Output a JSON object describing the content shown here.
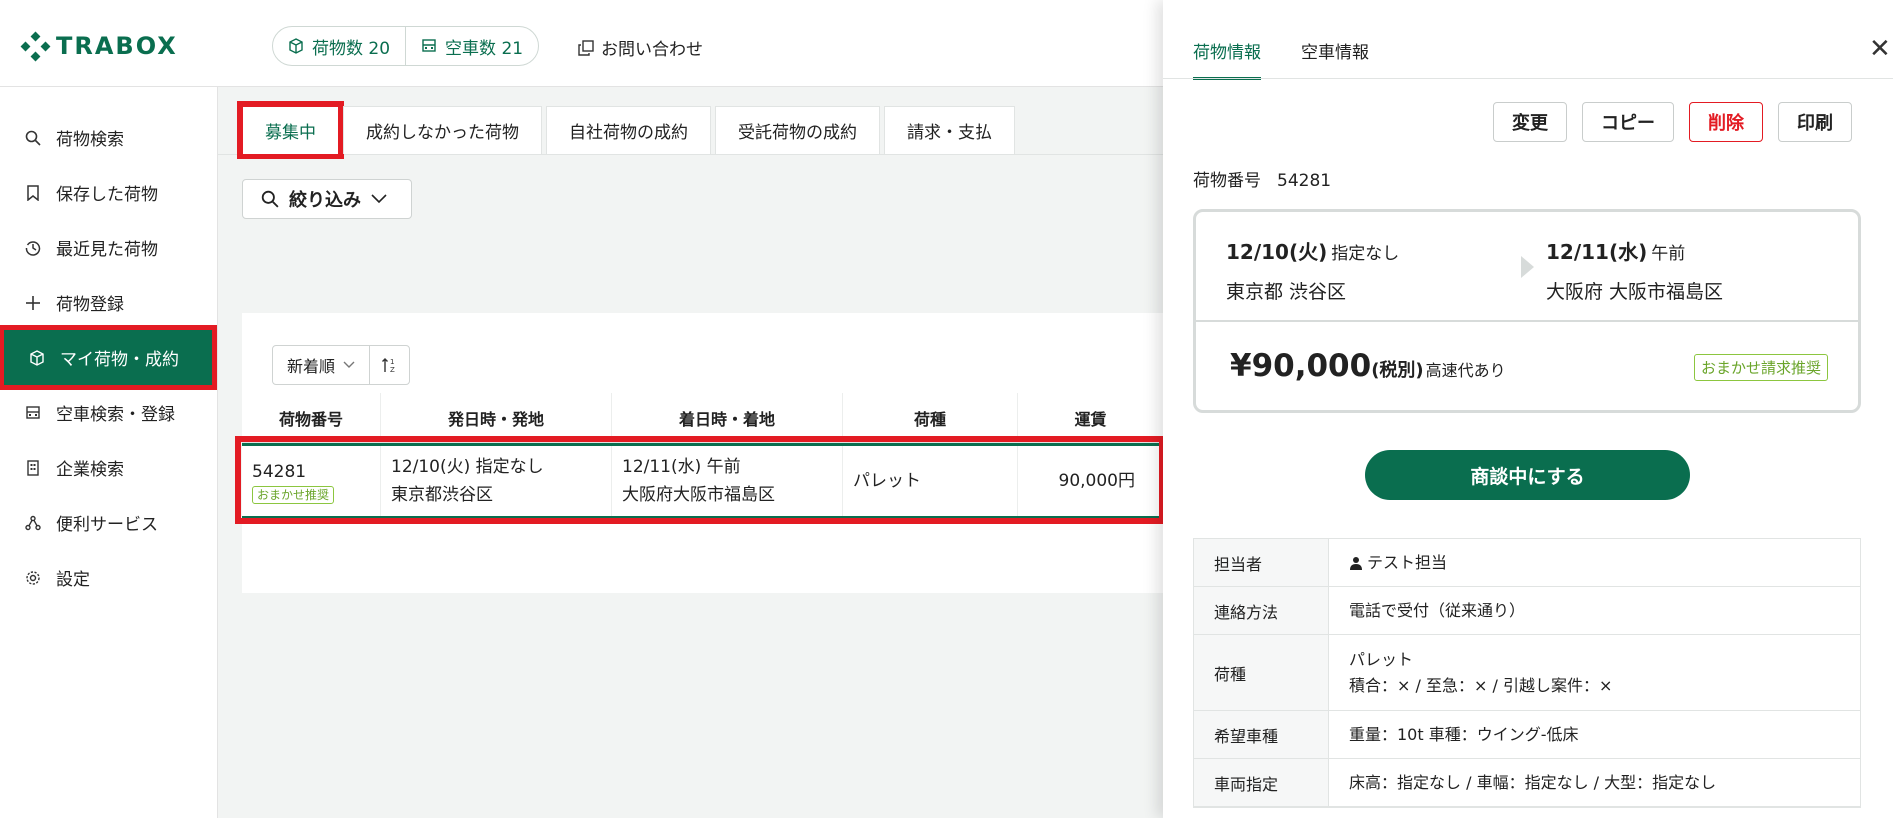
{
  "header": {
    "logo_text": "TRABOX",
    "cargo_count_label": "荷物数 20",
    "truck_count_label": "空車数 21",
    "contact_label": "お問い合わせ"
  },
  "sidebar": {
    "items": [
      {
        "label": "荷物検索",
        "icon": "search-icon"
      },
      {
        "label": "保存した荷物",
        "icon": "bookmark-icon"
      },
      {
        "label": "最近見た荷物",
        "icon": "history-icon"
      },
      {
        "label": "荷物登録",
        "icon": "plus-icon"
      },
      {
        "label": "マイ荷物・成約",
        "icon": "box-icon",
        "active": true
      },
      {
        "label": "空車検索・登録",
        "icon": "truck-icon"
      },
      {
        "label": "企業検索",
        "icon": "building-icon"
      },
      {
        "label": "便利サービス",
        "icon": "network-icon"
      },
      {
        "label": "設定",
        "icon": "gear-icon"
      }
    ]
  },
  "main": {
    "tabs": [
      "募集中",
      "成約しなかった荷物",
      "自社荷物の成約",
      "受託荷物の成約",
      "請求・支払"
    ],
    "filter_label": "絞り込み",
    "sort_label": "新着順",
    "columns": [
      "荷物番号",
      "発日時・発地",
      "着日時・着地",
      "荷種",
      "運賃"
    ],
    "rows": [
      {
        "number": "54281",
        "badge": "おまかせ推奨",
        "depart_datetime": "12/10(火) 指定なし",
        "depart_place": "東京都渋谷区",
        "arrive_datetime": "12/11(水) 午前",
        "arrive_place": "大阪府大阪市福島区",
        "cargo_type": "パレット",
        "fare": "90,000円"
      }
    ]
  },
  "drawer": {
    "tabs": [
      "荷物情報",
      "空車情報"
    ],
    "actions": [
      "変更",
      "コピー",
      "削除",
      "印刷"
    ],
    "cargo_no_label": "荷物番号",
    "cargo_no": "54281",
    "depart_date": "12/10(火)",
    "depart_time": "指定なし",
    "depart_place": "東京都 渋谷区",
    "arrive_date": "12/11(水)",
    "arrive_time": "午前",
    "arrive_place": "大阪府 大阪市福島区",
    "fare_amount": "¥90,000",
    "fare_tax": "(税別)",
    "fare_note": "高速代あり",
    "fare_badge": "おまかせ請求推奨",
    "cta_label": "商談中にする",
    "details": [
      {
        "label": "担当者",
        "lines": [
          "テスト担当"
        ]
      },
      {
        "label": "連絡方法",
        "lines": [
          "電話で受付（従来通り）"
        ]
      },
      {
        "label": "荷種",
        "lines": [
          "パレット",
          "積合：× / 至急：× / 引越し案件：×"
        ]
      },
      {
        "label": "希望車種",
        "lines": [
          "重量：10t 車種：ウイング-低床"
        ]
      },
      {
        "label": "車両指定",
        "lines": [
          "床高：指定なし / 車幅：指定なし / 大型：指定なし"
        ]
      }
    ]
  },
  "colors": {
    "brand": "#0a6e4f",
    "highlight": "#e31b23",
    "badge": "#8cc63f"
  }
}
